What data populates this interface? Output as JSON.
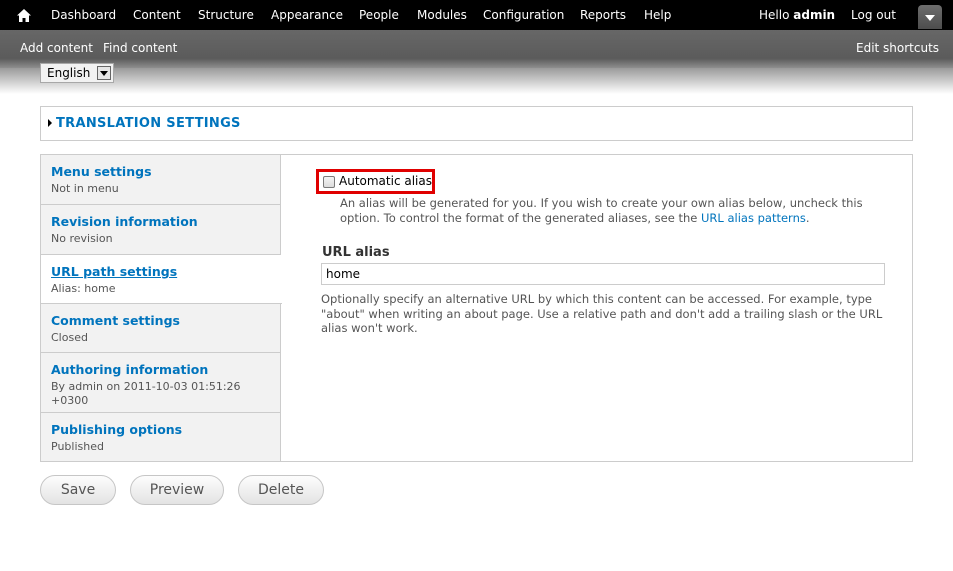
{
  "toolbar": {
    "home_icon": "home-icon",
    "menu": [
      "Dashboard",
      "Content",
      "Structure",
      "Appearance",
      "People",
      "Modules",
      "Configuration",
      "Reports",
      "Help"
    ],
    "hello_prefix": "Hello",
    "username": "admin",
    "logout": "Log out",
    "toggle_icon": "chevron-down-icon"
  },
  "shortcuts": {
    "items": [
      "Add content",
      "Find content"
    ],
    "edit": "Edit shortcuts"
  },
  "language": {
    "selected": "English"
  },
  "translation_settings": {
    "label": "TRANSLATION SETTINGS"
  },
  "vertical_tabs": [
    {
      "title": "Menu settings",
      "summary": "Not in menu"
    },
    {
      "title": "Revision information",
      "summary": "No revision"
    },
    {
      "title": "URL path settings",
      "summary": "Alias: home"
    },
    {
      "title": "Comment settings",
      "summary": "Closed"
    },
    {
      "title": "Authoring information",
      "summary": "By admin on 2011-10-03 01:51:26 +0300"
    },
    {
      "title": "Publishing options",
      "summary": "Published"
    }
  ],
  "pane": {
    "automatic_alias_label": "Automatic alias",
    "automatic_alias_checked": false,
    "automatic_alias_desc": "An alias will be generated for you. If you wish to create your own alias below, uncheck this option. To control the format of the generated aliases, see the",
    "automatic_alias_link": "URL alias patterns",
    "automatic_alias_end": ".",
    "url_alias_label": "URL alias",
    "url_alias_value": "home",
    "url_alias_desc": "Optionally specify an alternative URL by which this content can be accessed. For example, type \"about\" when writing an about page. Use a relative path and don't add a trailing slash or the URL alias won't work."
  },
  "actions": {
    "save": "Save",
    "preview": "Preview",
    "delete": "Delete"
  },
  "colors": {
    "link": "#0074bd",
    "highlight": "#e00000",
    "toolbar": "#000000"
  }
}
